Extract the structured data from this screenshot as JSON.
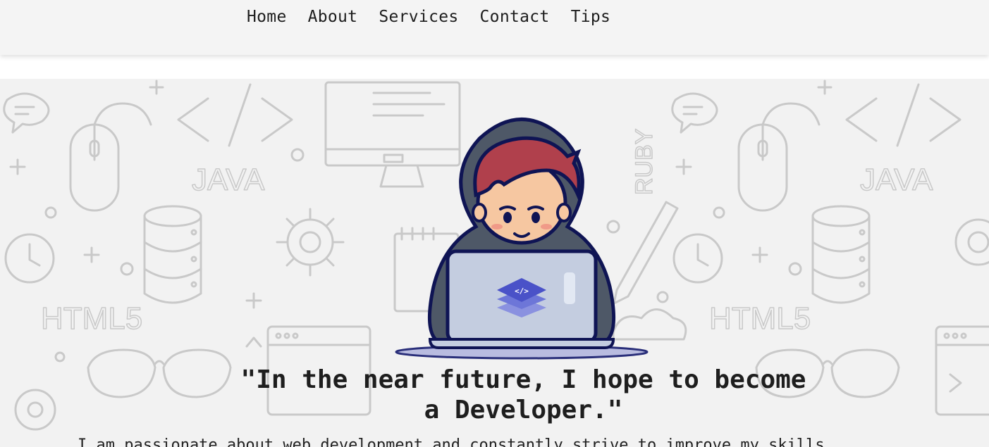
{
  "nav": {
    "items": [
      {
        "label": "Home"
      },
      {
        "label": "About"
      },
      {
        "label": "Services"
      },
      {
        "label": "Contact"
      },
      {
        "label": "Tips"
      }
    ]
  },
  "hero": {
    "quote": "\"In the near future, I hope to become a Developer.\"",
    "intro": "I am passionate about web development and constantly strive to improve my skills",
    "background_words": [
      "JAVA",
      "RUBY",
      "HTML5"
    ],
    "illustration": "developer-with-laptop-illustration"
  },
  "colors": {
    "nav_bg": "#f4f4f4",
    "hero_bg": "#f2f2f2",
    "doodle_stroke": "#c9c9c9",
    "hood": "#4e5867",
    "hair": "#b0404c",
    "laptop": "#c4cde0",
    "logo": "#4a52c8"
  }
}
